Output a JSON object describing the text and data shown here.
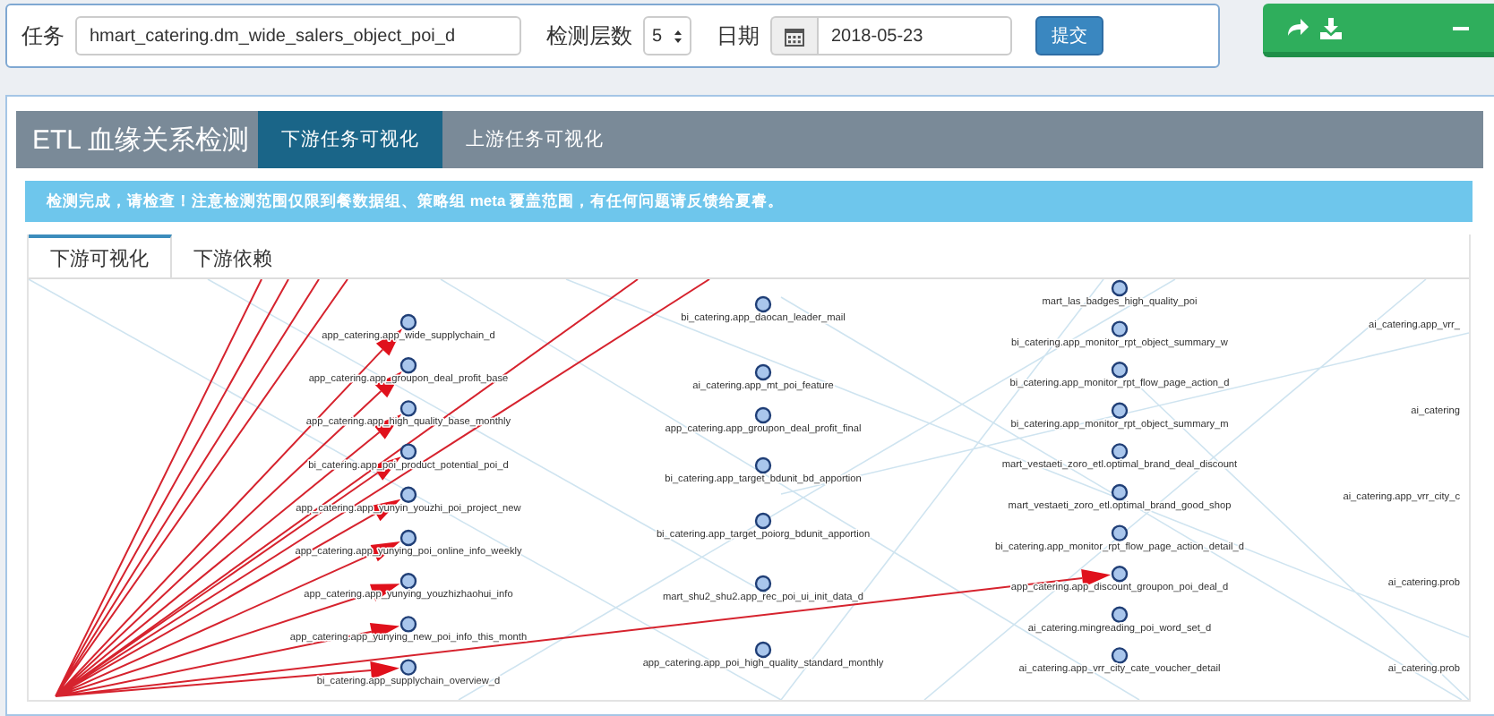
{
  "task_form": {
    "task_label": "任务",
    "task_value": "hmart_catering.dm_wide_salers_object_poi_d",
    "depth_label": "检测层数",
    "depth_value": "5",
    "date_label": "日期",
    "date_value": "2018-05-23",
    "submit": "提交"
  },
  "title": "ETL 血缘关系检测",
  "tabs": [
    {
      "label": "下游任务可视化",
      "selected": true
    },
    {
      "label": "上游任务可视化",
      "selected": false
    }
  ],
  "alert": "检测完成，请检查！注意检测范围仅限到餐数据组、策略组 meta 覆盖范围，有任何问题请反馈给夏睿。",
  "subtabs": [
    {
      "label": "下游可视化",
      "selected": true
    },
    {
      "label": "下游依赖",
      "selected": false
    }
  ],
  "graph": {
    "columns": [
      {
        "nodes": [
          {
            "label": "app_catering.app_wide_supplychain_d"
          },
          {
            "label": "app_catering.app_groupon_deal_profit_base"
          },
          {
            "label": "app_catering.app_high_quality_base_monthly"
          },
          {
            "label": "bi_catering.app_poi_product_potential_poi_d"
          },
          {
            "label": "app_catering.app_yunyin_youzhi_poi_project_new"
          },
          {
            "label": "app_catering.app_yunying_poi_online_info_weekly"
          },
          {
            "label": "app_catering.app_yunying_youzhizhaohui_info"
          },
          {
            "label": "app_catering.app_yunying_new_poi_info_this_month"
          },
          {
            "label": "bi_catering.app_supplychain_overview_d"
          }
        ]
      },
      {
        "nodes": [
          {
            "label": "bi_catering.app_daocan_leader_mail"
          },
          {
            "label": "ai_catering.app_mt_poi_feature"
          },
          {
            "label": "app_catering.app_groupon_deal_profit_final"
          },
          {
            "label": "bi_catering.app_target_bdunit_bd_apportion"
          },
          {
            "label": "bi_catering.app_target_poiorg_bdunit_apportion"
          },
          {
            "label": "mart_shu2_shu2.app_rec_poi_ui_init_data_d"
          },
          {
            "label": "app_catering.app_poi_high_quality_standard_monthly"
          }
        ]
      },
      {
        "nodes": [
          {
            "label": "mart_las_badges_high_quality_poi"
          },
          {
            "label": "bi_catering.app_monitor_rpt_object_summary_w"
          },
          {
            "label": "bi_catering.app_monitor_rpt_flow_page_action_d"
          },
          {
            "label": "bi_catering.app_monitor_rpt_object_summary_m"
          },
          {
            "label": "mart_vestaeti_zoro_etl.optimal_brand_deal_discount"
          },
          {
            "label": "mart_vestaeti_zoro_etl.optimal_brand_good_shop"
          },
          {
            "label": "bi_catering.app_monitor_rpt_flow_page_action_detail_d"
          },
          {
            "label": "app_catering.app_discount_groupon_poi_deal_d"
          },
          {
            "label": "ai_catering.mingreading_poi_word_set_d"
          },
          {
            "label": "ai_catering.app_vrr_city_cate_voucher_detail"
          }
        ]
      },
      {
        "nodes": [
          {
            "label": "ai_catering.app_vrr_"
          },
          {
            "label": "ai_catering"
          },
          {
            "label": "ai_catering.app_vrr_city_c"
          },
          {
            "label": "ai_catering.prob"
          },
          {
            "label": "ai_catering.prob"
          }
        ]
      }
    ]
  }
}
